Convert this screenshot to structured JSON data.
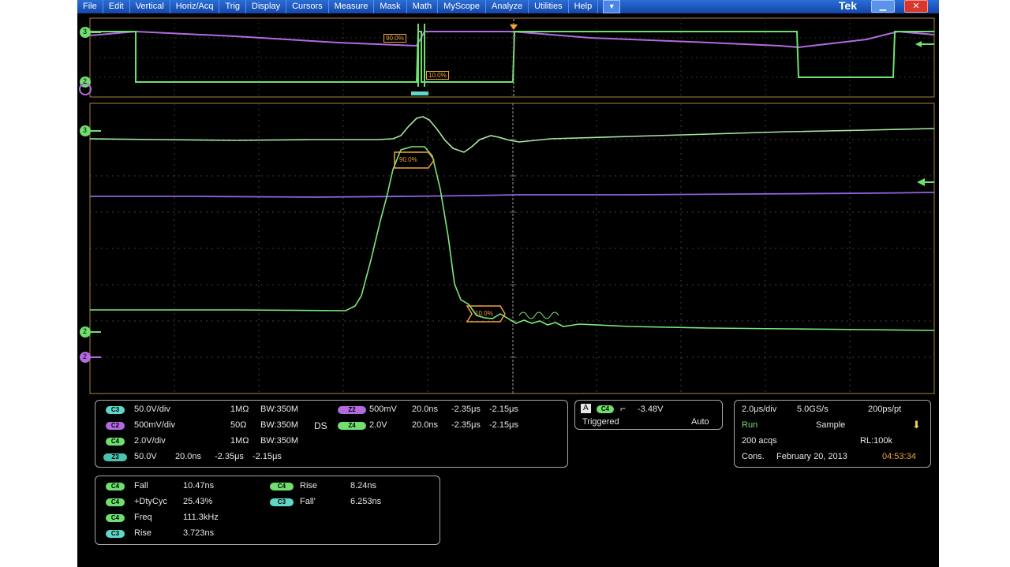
{
  "menu": {
    "items": [
      "File",
      "Edit",
      "Vertical",
      "Horiz/Acq",
      "Trig",
      "Display",
      "Cursors",
      "Measure",
      "Mask",
      "Math",
      "MyScope",
      "Analyze",
      "Utilities",
      "Help"
    ],
    "dropdown_icon": "chevron-down-icon"
  },
  "brand": "Tek",
  "window": {
    "minimize_icon": "minimize-icon",
    "close_icon": "close-icon"
  },
  "colors": {
    "ch1": "#6fe06f",
    "ch2": "#b36ae0",
    "ch3": "#5fd8c8",
    "cursor": "#f0a43a",
    "background": "#000000"
  },
  "overview": {
    "ch_markers": [
      "3",
      "2"
    ],
    "labels": {
      "top": "90.0%",
      "bottom": "10.0%"
    }
  },
  "main_view": {
    "ch_markers": {
      "top": "3",
      "lower": "2",
      "ref": "2"
    },
    "labels": {
      "upper": "90.0%",
      "lower": "10.0%"
    }
  },
  "channels": [
    {
      "badge": "C3",
      "scale": "50.0V/div",
      "impedance": "1MΩ",
      "bw": "BW:350M"
    },
    {
      "badge": "C2",
      "scale": "500mV/div",
      "impedance": "50Ω",
      "bw": "BW:350M"
    },
    {
      "badge": "C4",
      "scale": "2.0V/div",
      "impedance": "1MΩ",
      "bw": "BW:350M"
    },
    {
      "badge": "Z3",
      "scale": "50.0V",
      "time": "20.0ns",
      "t1": "-2.35μs",
      "t2": "-2.15μs"
    }
  ],
  "ds_label": "DS",
  "ref_channels": [
    {
      "badge": "Z2",
      "scale": "500mV",
      "time": "20.0ns",
      "t1": "-2.35μs",
      "t2": "-2.15μs"
    },
    {
      "badge": "Z4",
      "scale": "2.0V",
      "time": "20.0ns",
      "t1": "-2.35μs",
      "t2": "-2.15μs"
    }
  ],
  "trigger": {
    "mode_icon": "A",
    "channel": "C4",
    "slope_icon": "falling-edge-icon",
    "level": "-3.48V",
    "status": "Triggered",
    "mode": "Auto"
  },
  "acquisition": {
    "horiz": "2.0μs/div",
    "rate": "5.0GS/s",
    "res": "200ps/pt",
    "state": "Run",
    "mode": "Sample",
    "acqs": "200 acqs",
    "rl": "RL:100k",
    "cons_label": "Cons.",
    "date": "February 20, 2013",
    "time": "04:53:34"
  },
  "measurements": [
    {
      "badge": "C4",
      "name": "Fall",
      "value": "10.47ns"
    },
    {
      "badge": "C4",
      "name": "+DtyCyc",
      "value": "25.43%"
    },
    {
      "badge": "C4",
      "name": "Freq",
      "value": "111.3kHz"
    },
    {
      "badge": "C3",
      "name": "Rise",
      "value": "3.723ns"
    }
  ],
  "measurements_right": [
    {
      "badge": "C4",
      "name": "Rise",
      "value": "8.24ns"
    },
    {
      "badge": "C3",
      "name": "Fall'",
      "value": "6.253ns"
    }
  ]
}
